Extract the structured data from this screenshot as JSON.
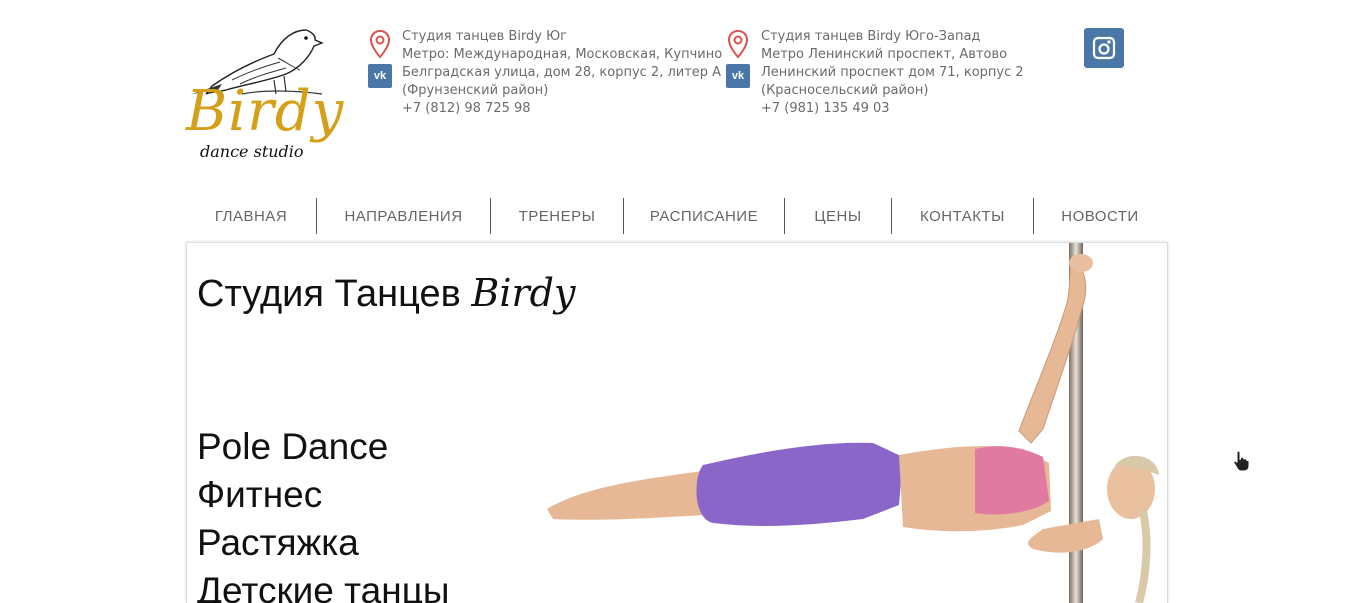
{
  "logo": {
    "text": "Birdy",
    "subtitle": "dance studio"
  },
  "contacts": [
    {
      "title": "Студия танцев Birdy Юг",
      "metro": "Метро: Международная, Московская, Купчино",
      "address": "Белградская улица, дом 28, корпус 2, литер А",
      "district": "(Фрунзенский район)",
      "phone": "+7 (812) 98 725 98"
    },
    {
      "title": "Студия танцев Birdy Юго-Запад",
      "metro": "Метро Ленинский проспект, Автово",
      "address": "Ленинский проспект дом 71, корпус 2",
      "district": "(Красносельский район)",
      "phone": "+7 (981) 135 49 03"
    }
  ],
  "icons": {
    "location": "location-pin-icon",
    "vk": "vk-icon",
    "instagram": "instagram-icon",
    "cursor": "hand-cursor-icon"
  },
  "nav": [
    {
      "label": "ГЛАВНАЯ"
    },
    {
      "label": "НАПРАВЛЕНИЯ"
    },
    {
      "label": "ТРЕНЕРЫ"
    },
    {
      "label": "РАСПИСАНИЕ"
    },
    {
      "label": "ЦЕНЫ"
    },
    {
      "label": "КОНТАКТЫ"
    },
    {
      "label": "НОВОСТИ"
    }
  ],
  "hero": {
    "title_prefix": "Студия Танцев ",
    "title_brand": "Birdy",
    "services": [
      "Pole Dance",
      "Фитнес",
      "Растяжка",
      "Детские танцы"
    ]
  },
  "colors": {
    "brand_gold": "#d4a017",
    "vk_blue": "#4a76a8",
    "pin_red": "#d9534f"
  }
}
